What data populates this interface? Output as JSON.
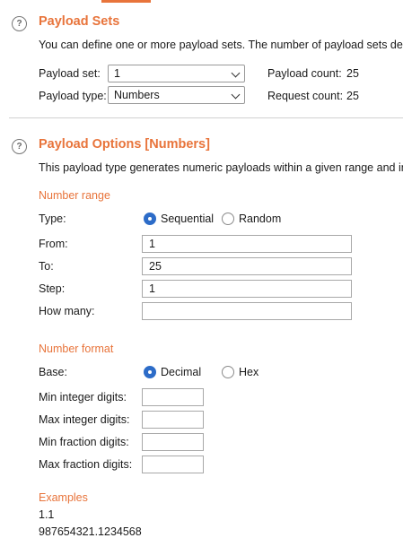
{
  "payload_sets": {
    "title": "Payload Sets",
    "description": "You can define one or more payload sets. The number of payload sets dep",
    "payload_set_label": "Payload set:",
    "payload_set_value": "1",
    "payload_type_label": "Payload type:",
    "payload_type_value": "Numbers",
    "payload_count_label": "Payload count:",
    "payload_count_value": "25",
    "request_count_label": "Request count:",
    "request_count_value": "25"
  },
  "payload_options": {
    "title": "Payload Options [Numbers]",
    "description": "This payload type generates numeric payloads within a given range and in",
    "number_range": {
      "title": "Number range",
      "type_label": "Type:",
      "type_options": [
        "Sequential",
        "Random"
      ],
      "type_selected": "Sequential",
      "from_label": "From:",
      "from_value": "1",
      "to_label": "To:",
      "to_value": "25",
      "step_label": "Step:",
      "step_value": "1",
      "how_many_label": "How many:",
      "how_many_value": ""
    },
    "number_format": {
      "title": "Number format",
      "base_label": "Base:",
      "base_options": [
        "Decimal",
        "Hex"
      ],
      "base_selected": "Decimal",
      "min_integer_label": "Min integer digits:",
      "max_integer_label": "Max integer digits:",
      "min_fraction_label": "Min fraction digits:",
      "max_fraction_label": "Max fraction digits:",
      "min_integer_value": "",
      "max_integer_value": "",
      "min_fraction_value": "",
      "max_fraction_value": ""
    },
    "examples": {
      "title": "Examples",
      "lines": [
        "1.1",
        "987654321.1234568"
      ]
    }
  },
  "colors": {
    "accent": "#e8743b",
    "radio_selected": "#2d6cc8"
  },
  "icons": [
    "help-icon",
    "chevron-down-icon"
  ]
}
